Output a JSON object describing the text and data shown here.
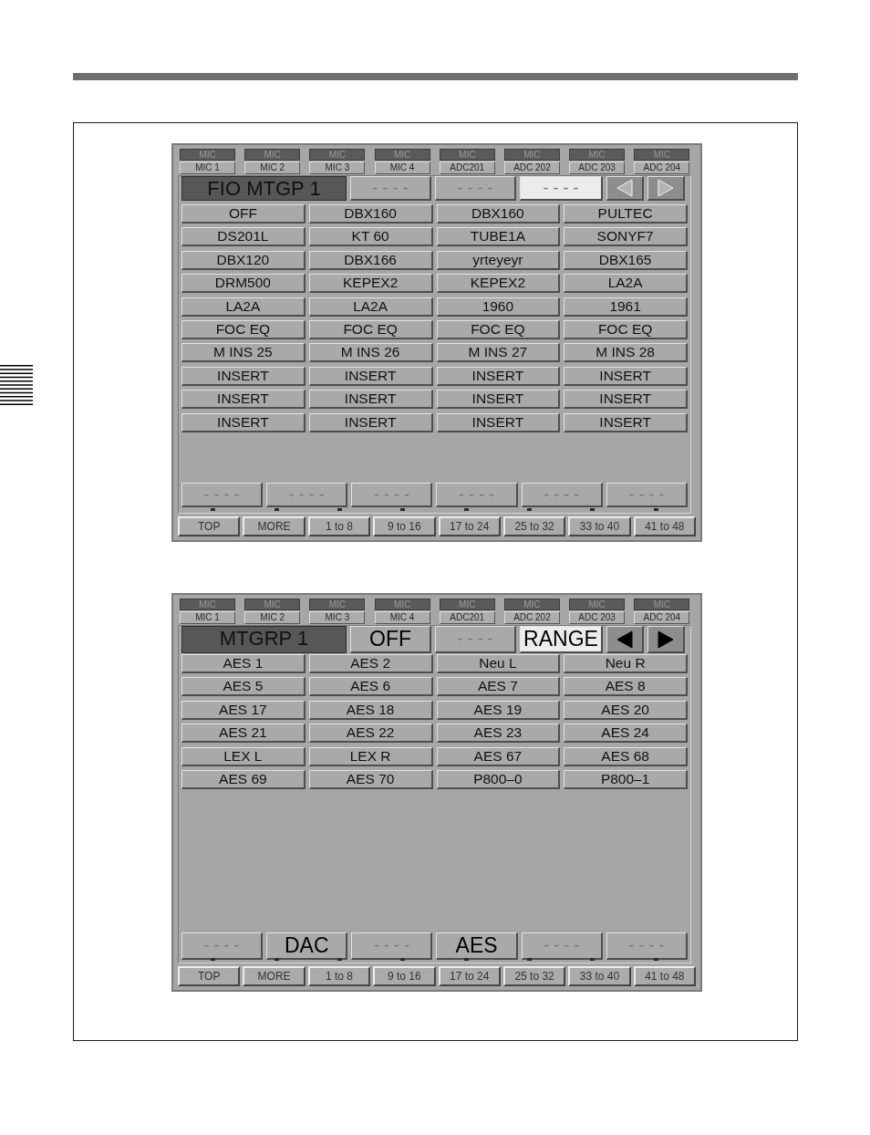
{
  "panels": [
    {
      "channel_tabs": [
        {
          "group": "MIC",
          "name": "MIC 1"
        },
        {
          "group": "MIC",
          "name": "MIC 2"
        },
        {
          "group": "MIC",
          "name": "MIC 3"
        },
        {
          "group": "MIC",
          "name": "MIC 4"
        },
        {
          "group": "MIC",
          "name": "ADC201"
        },
        {
          "group": "MIC",
          "name": "ADC 202"
        },
        {
          "group": "MIC",
          "name": "ADC 203"
        },
        {
          "group": "MIC",
          "name": "ADC 204"
        }
      ],
      "title": "FIO MTGP 1",
      "header_slots": [
        {
          "label": "----",
          "assigned": false,
          "selected": false
        },
        {
          "label": "----",
          "assigned": false,
          "selected": false
        },
        {
          "label": "----",
          "assigned": false,
          "selected": true
        }
      ],
      "arrows": [
        {
          "kind": "left",
          "disabled": true
        },
        {
          "kind": "right",
          "disabled": true
        }
      ],
      "grid": [
        [
          "OFF",
          "DBX160",
          "DBX160",
          "PULTEC"
        ],
        [
          "DS201L",
          "KT 60",
          "TUBE1A",
          "SONYF7"
        ],
        [
          "DBX120",
          "DBX166",
          "yrteyeyr",
          "DBX165"
        ],
        [
          "DRM500",
          "KEPEX2",
          "KEPEX2",
          "LA2A"
        ],
        [
          "LA2A",
          "LA2A",
          "1960",
          "1961"
        ],
        [
          "FOC EQ",
          "FOC EQ",
          "FOC EQ",
          "FOC EQ"
        ],
        [
          "M INS 25",
          "M INS 26",
          "M INS 27",
          "M INS 28"
        ],
        [
          "INSERT",
          "INSERT",
          "INSERT",
          "INSERT"
        ],
        [
          "INSERT",
          "INSERT",
          "INSERT",
          "INSERT"
        ],
        [
          "INSERT",
          "INSERT",
          "INSERT",
          "INSERT"
        ]
      ],
      "function_buttons": [
        {
          "label": "----",
          "assigned": false
        },
        {
          "label": "----",
          "assigned": false
        },
        {
          "label": "----",
          "assigned": false
        },
        {
          "label": "----",
          "assigned": false
        },
        {
          "label": "----",
          "assigned": false
        },
        {
          "label": "----",
          "assigned": false
        }
      ],
      "nav_buttons": [
        "TOP",
        "MORE",
        "1 to 8",
        "9 to 16",
        "17 to 24",
        "25 to 32",
        "33 to 40",
        "41 to 48"
      ]
    },
    {
      "channel_tabs": [
        {
          "group": "MIC",
          "name": "MIC 1"
        },
        {
          "group": "MIC",
          "name": "MIC 2"
        },
        {
          "group": "MIC",
          "name": "MIC 3"
        },
        {
          "group": "MIC",
          "name": "MIC 4"
        },
        {
          "group": "MIC",
          "name": "ADC201"
        },
        {
          "group": "MIC",
          "name": "ADC 202"
        },
        {
          "group": "MIC",
          "name": "ADC 203"
        },
        {
          "group": "MIC",
          "name": "ADC 204"
        }
      ],
      "title": "MTGRP 1",
      "header_slots": [
        {
          "label": "OFF",
          "assigned": true,
          "selected": false
        },
        {
          "label": "----",
          "assigned": false,
          "selected": false
        },
        {
          "label": "RANGE",
          "assigned": true,
          "selected": true
        }
      ],
      "arrows": [
        {
          "kind": "left",
          "disabled": false
        },
        {
          "kind": "right",
          "disabled": false
        }
      ],
      "grid": [
        [
          "AES 1",
          "AES 2",
          "Neu L",
          "Neu R"
        ],
        [
          "AES 5",
          "AES 6",
          "AES 7",
          "AES 8"
        ],
        [
          "AES 17",
          "AES 18",
          "AES 19",
          "AES 20"
        ],
        [
          "AES 21",
          "AES 22",
          "AES 23",
          "AES 24"
        ],
        [
          "LEX L",
          "LEX R",
          "AES 67",
          "AES 68"
        ],
        [
          "AES 69",
          "AES 70",
          "P800–0",
          "P800–1"
        ]
      ],
      "function_buttons": [
        {
          "label": "----",
          "assigned": false
        },
        {
          "label": "DAC",
          "assigned": true
        },
        {
          "label": "----",
          "assigned": false
        },
        {
          "label": "AES",
          "assigned": true
        },
        {
          "label": "----",
          "assigned": false
        },
        {
          "label": "----",
          "assigned": false
        }
      ],
      "nav_buttons": [
        "TOP",
        "MORE",
        "1 to 8",
        "9 to 16",
        "17 to 24",
        "25 to 32",
        "33 to 40",
        "41 to 48"
      ]
    }
  ]
}
